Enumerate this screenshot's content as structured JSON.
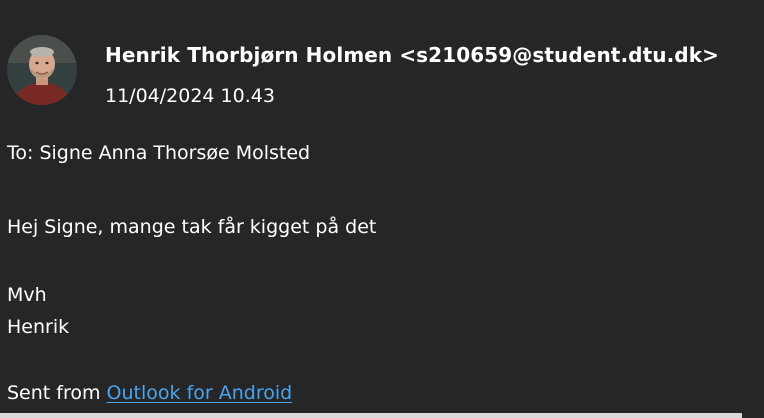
{
  "header": {
    "sender": "Henrik Thorbjørn Holmen <s210659@student.dtu.dk>",
    "date": "11/04/2024 10.43"
  },
  "recipients": {
    "to_line": "To: Signe Anna Thorsøe Molsted"
  },
  "body": {
    "lines": [
      "Hej Signe, mange tak får kigget på det",
      "Mvh",
      "Henrik"
    ]
  },
  "signature": {
    "prefix": "Sent from ",
    "link_text": "Outlook for Android"
  },
  "colors": {
    "background": "#262626",
    "text": "#ffffff",
    "link": "#4aa3ee"
  }
}
